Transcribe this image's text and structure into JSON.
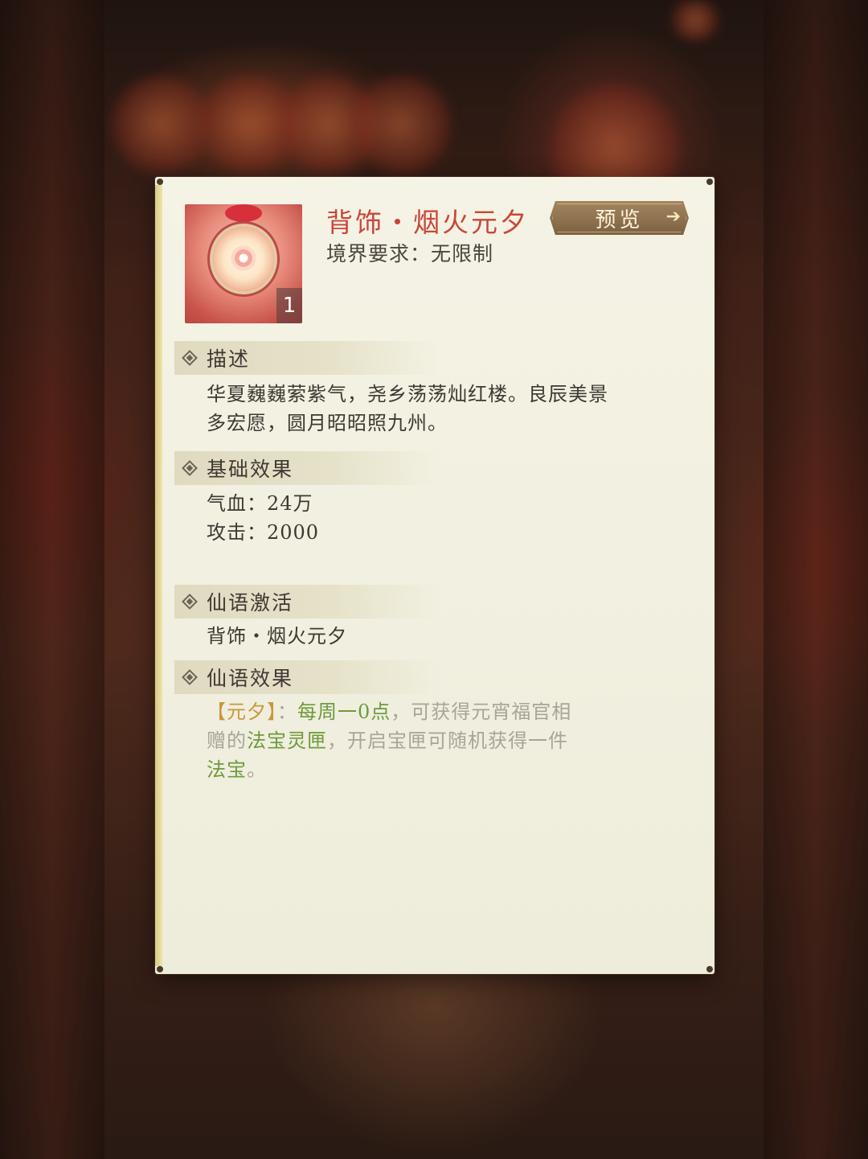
{
  "item": {
    "name": "背饰・烟火元夕",
    "realm_requirement": "境界要求：无限制",
    "count": "1"
  },
  "preview_button": {
    "label": "预览"
  },
  "sections": {
    "description": {
      "title": "描述",
      "line1": "华夏巍巍萦紫气，尧乡荡荡灿红楼。良辰美景",
      "line2": "多宏愿，圆月昭昭照九州。"
    },
    "base_effects": {
      "title": "基础效果",
      "hp": "气血：24万",
      "attack": "攻击：2000"
    },
    "xianyu_activation": {
      "title": "仙语激活",
      "value": "背饰・烟火元夕"
    },
    "xianyu_effect": {
      "title": "仙语效果",
      "tag": "【元夕】",
      "colon": "：",
      "time": "每周一0点",
      "text1": "，可获得元宵福官相",
      "text2a": "赠的",
      "reward": "法宝灵匣",
      "text2b": "，开启宝匣可随机获得一件",
      "reward2": "法宝",
      "end": "。"
    }
  },
  "colors": {
    "item_name": "#c9463a",
    "highlight_gold": "#c9973c",
    "highlight_green": "#6d9a3c",
    "muted_text": "#a8a598",
    "card_bg": "#f2f0e0"
  }
}
